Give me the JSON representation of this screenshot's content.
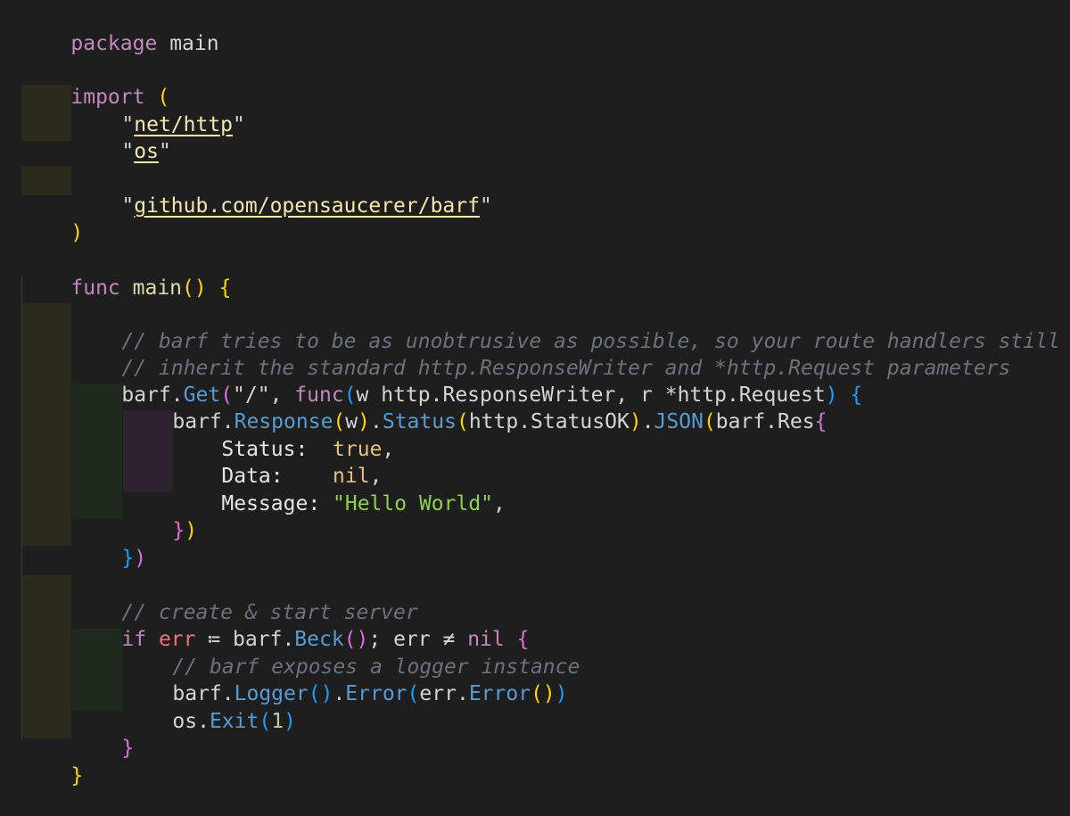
{
  "editor": {
    "language": "go",
    "theme_background": "#1e1e1e",
    "colors": {
      "keyword": "#c586c0",
      "method": "#569cd6",
      "comment": "#6a737d",
      "bracket_level_1": "#ffd700",
      "bracket_level_2": "#da70d6",
      "bracket_level_3": "#179fff",
      "string_green": "#8fd14f",
      "variable": "#f07178",
      "import_path": "#f5e7b0"
    }
  },
  "code": {
    "l1": {
      "kw": "package",
      "name": "main"
    },
    "l3": {
      "kw": "import",
      "open": "("
    },
    "l4": {
      "path": "net/http"
    },
    "l5": {
      "path": "os"
    },
    "l7": {
      "path": "github.com/opensaucerer/barf"
    },
    "l8": {
      "close": ")"
    },
    "l10": {
      "kw": "func",
      "name": "main",
      "parens": "()",
      "brace": "{"
    },
    "l12": {
      "comment": "// barf tries to be as unobtrusive as possible, so your route handlers still"
    },
    "l13": {
      "comment": "// inherit the standard http.ResponseWriter and *http.Request parameters"
    },
    "l14": {
      "obj": "barf",
      "dot": ".",
      "method": "Get",
      "open": "(",
      "route": "\"/\"",
      "comma": ", ",
      "kw": "func",
      "popen": "(",
      "params": "w http.ResponseWriter, r *http.Request",
      "pclose": ")",
      "brace": " {"
    },
    "l15": {
      "obj": "barf",
      "method1": "Response",
      "arg1": "w",
      "method2": "Status",
      "arg2": "http.StatusOK",
      "method3": "JSON",
      "arg3": "barf.Res",
      "brace": "{"
    },
    "l16": {
      "field": "Status:  ",
      "value": "true",
      "comma": ","
    },
    "l17": {
      "field": "Data:    ",
      "value": "nil",
      "comma": ","
    },
    "l18": {
      "field": "Message: ",
      "value": "\"Hello World\"",
      "comma": ","
    },
    "l19": {
      "close": "})"
    },
    "l20": {
      "close": "})"
    },
    "l22": {
      "comment": "// create & start server"
    },
    "l23": {
      "kw": "if",
      "var1": "err",
      "op1": " ≔ ",
      "obj": "barf",
      "method": "Beck",
      "call": "()",
      "semi": "; ",
      "var2": "err",
      "op2": " ≠ ",
      "nil": "nil",
      "brace": " {"
    },
    "l24": {
      "comment": "// barf exposes a logger instance"
    },
    "l25": {
      "obj": "barf",
      "method1": "Logger",
      "method2": "Error",
      "arg": "err",
      "method3": "Error"
    },
    "l26": {
      "obj": "os",
      "method": "Exit",
      "arg": "1"
    },
    "l27": {
      "close": "}"
    },
    "l28": {
      "close": "}"
    }
  }
}
